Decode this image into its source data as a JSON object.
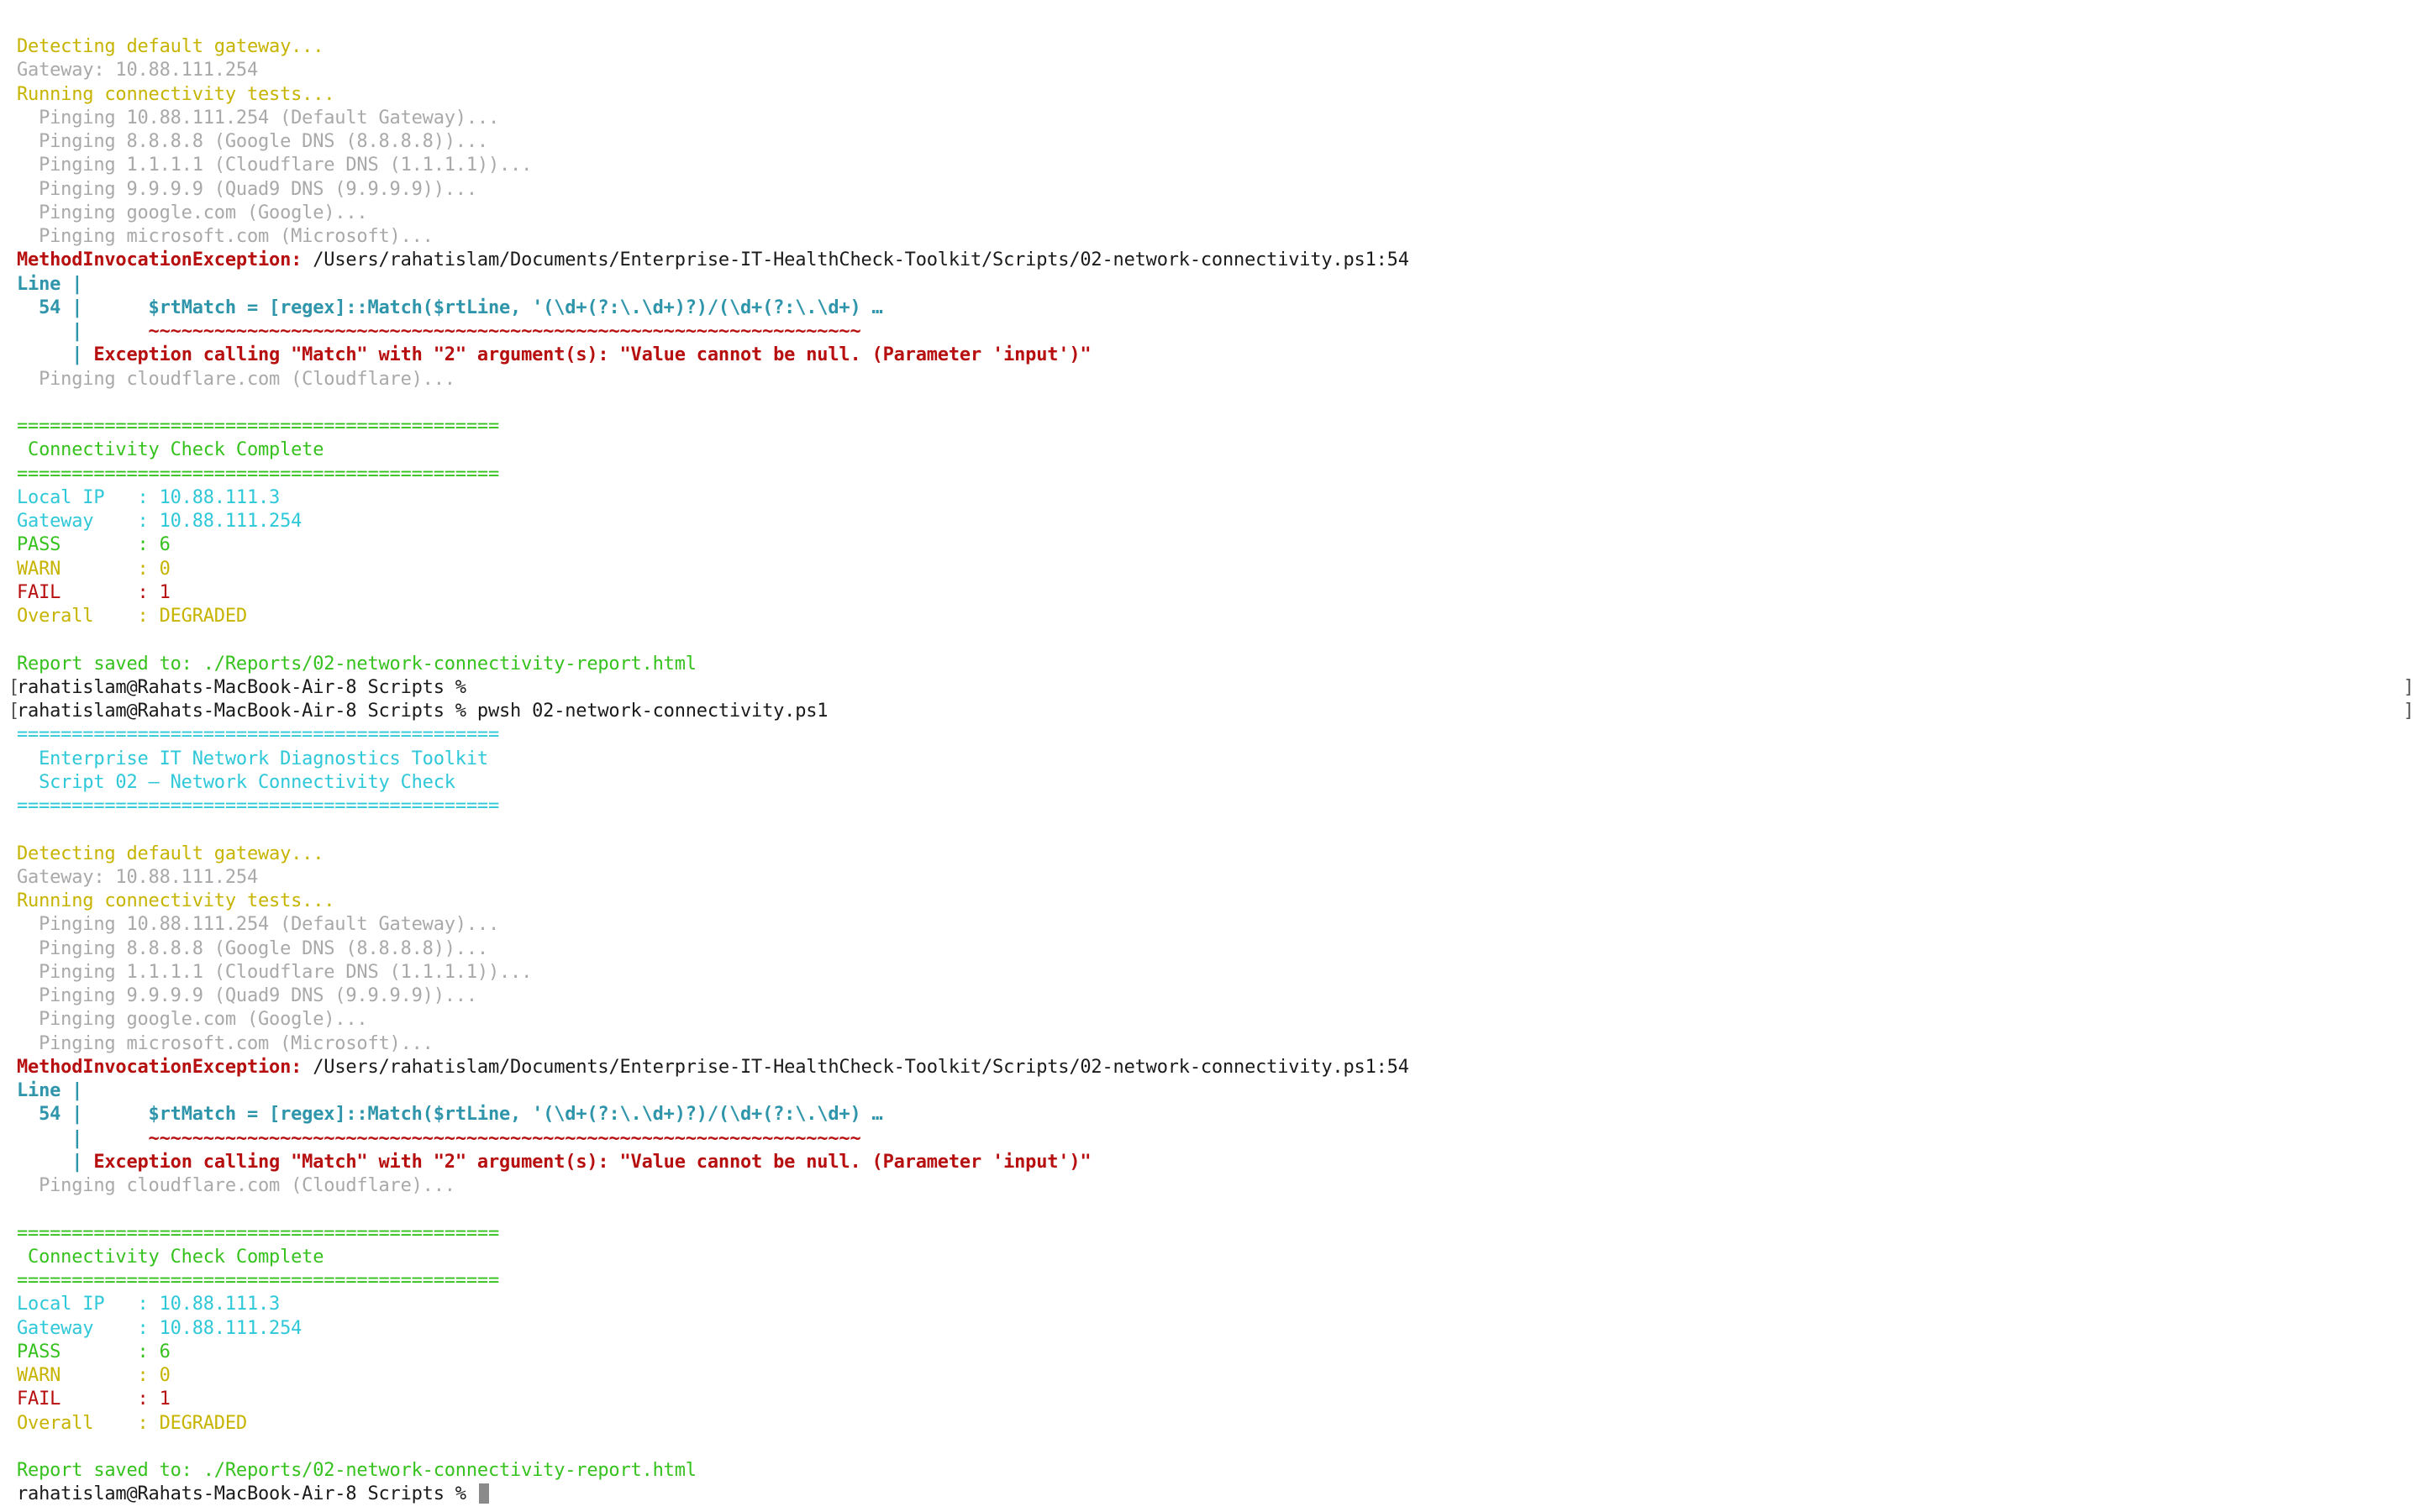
{
  "colors": {
    "yellow": "#c7b400",
    "gray": "#a9a9a9",
    "green": "#36c21e",
    "cyan": "#2ec8d8",
    "red": "#b70f0f",
    "teal": "#2f95ab",
    "default": "#1a1a1a",
    "background": "#ffffff",
    "cursor": "#8a8a8a"
  },
  "terminal_lines": [
    {
      "segs": [
        {
          "t": "Detecting default gateway...",
          "c": "yellow"
        }
      ]
    },
    {
      "segs": [
        {
          "t": "Gateway: 10.88.111.254",
          "c": "gray"
        }
      ]
    },
    {
      "segs": [
        {
          "t": "Running connectivity tests...",
          "c": "yellow"
        }
      ]
    },
    {
      "segs": [
        {
          "t": "  Pinging 10.88.111.254 (Default Gateway)...",
          "c": "gray"
        }
      ]
    },
    {
      "segs": [
        {
          "t": "  Pinging 8.8.8.8 (Google DNS (8.8.8.8))...",
          "c": "gray"
        }
      ]
    },
    {
      "segs": [
        {
          "t": "  Pinging 1.1.1.1 (Cloudflare DNS (1.1.1.1))...",
          "c": "gray"
        }
      ]
    },
    {
      "segs": [
        {
          "t": "  Pinging 9.9.9.9 (Quad9 DNS (9.9.9.9))...",
          "c": "gray"
        }
      ]
    },
    {
      "segs": [
        {
          "t": "  Pinging google.com (Google)...",
          "c": "gray"
        }
      ]
    },
    {
      "segs": [
        {
          "t": "  Pinging microsoft.com (Microsoft)...",
          "c": "gray"
        }
      ]
    },
    {
      "segs": [
        {
          "t": "MethodInvocationException:",
          "c": "red",
          "b": true
        },
        {
          "t": " /Users/rahatislam/Documents/Enterprise-IT-HealthCheck-Toolkit/Scripts/02-network-connectivity.ps1:54",
          "c": "default"
        }
      ]
    },
    {
      "segs": [
        {
          "t": "Line |",
          "c": "teal",
          "b": true
        }
      ]
    },
    {
      "segs": [
        {
          "t": "  54 | ",
          "c": "teal",
          "b": true
        },
        {
          "t": "     $rtMatch = [regex]::Match($rtLine, '(\\d+(?:\\.\\d+)?)/(\\d+(?:\\.\\d+) …",
          "c": "teal",
          "b": true
        }
      ]
    },
    {
      "segs": [
        {
          "t": "     | ",
          "c": "teal",
          "b": true
        },
        {
          "t": "     ~~~~~~~~~~~~~~~~~~~~~~~~~~~~~~~~~~~~~~~~~~~~~~~~~~~~~~~~~~~~~~~~~",
          "c": "red",
          "b": true
        }
      ]
    },
    {
      "segs": [
        {
          "t": "     | ",
          "c": "teal",
          "b": true
        },
        {
          "t": "Exception calling \"Match\" with \"2\" argument(s): \"Value cannot be null. (Parameter 'input')\"",
          "c": "red",
          "b": true
        }
      ]
    },
    {
      "segs": [
        {
          "t": "  Pinging cloudflare.com (Cloudflare)...",
          "c": "gray"
        }
      ]
    },
    {
      "segs": [
        {
          "t": "",
          "c": "default"
        }
      ]
    },
    {
      "segs": [
        {
          "t": "============================================",
          "c": "green"
        }
      ]
    },
    {
      "segs": [
        {
          "t": " Connectivity Check Complete",
          "c": "green"
        }
      ]
    },
    {
      "segs": [
        {
          "t": "============================================",
          "c": "green"
        }
      ]
    },
    {
      "segs": [
        {
          "t": "Local IP   : 10.88.111.3",
          "c": "cyan"
        }
      ]
    },
    {
      "segs": [
        {
          "t": "Gateway    : 10.88.111.254",
          "c": "cyan"
        }
      ]
    },
    {
      "segs": [
        {
          "t": "PASS       : 6",
          "c": "green"
        }
      ]
    },
    {
      "segs": [
        {
          "t": "WARN       : 0",
          "c": "yellow"
        }
      ]
    },
    {
      "segs": [
        {
          "t": "FAIL       : 1",
          "c": "red"
        }
      ]
    },
    {
      "segs": [
        {
          "t": "Overall    : DEGRADED",
          "c": "yellow"
        }
      ]
    },
    {
      "segs": [
        {
          "t": "",
          "c": "default"
        }
      ]
    },
    {
      "segs": [
        {
          "t": "Report saved to: ./Reports/02-network-connectivity-report.html",
          "c": "green"
        }
      ]
    },
    {
      "brackets": true,
      "segs": [
        {
          "t": "rahatislam@Rahats-MacBook-Air-8 Scripts % ",
          "c": "default"
        }
      ]
    },
    {
      "brackets": true,
      "segs": [
        {
          "t": "rahatislam@Rahats-MacBook-Air-8 Scripts % pwsh 02-network-connectivity.ps1",
          "c": "default"
        }
      ]
    },
    {
      "segs": [
        {
          "t": "============================================",
          "c": "cyan"
        }
      ]
    },
    {
      "segs": [
        {
          "t": "  Enterprise IT Network Diagnostics Toolkit",
          "c": "cyan"
        }
      ]
    },
    {
      "segs": [
        {
          "t": "  Script 02 — Network Connectivity Check",
          "c": "cyan"
        }
      ]
    },
    {
      "segs": [
        {
          "t": "============================================",
          "c": "cyan"
        }
      ]
    },
    {
      "segs": [
        {
          "t": "",
          "c": "default"
        }
      ]
    },
    {
      "segs": [
        {
          "t": "Detecting default gateway...",
          "c": "yellow"
        }
      ]
    },
    {
      "segs": [
        {
          "t": "Gateway: 10.88.111.254",
          "c": "gray"
        }
      ]
    },
    {
      "segs": [
        {
          "t": "Running connectivity tests...",
          "c": "yellow"
        }
      ]
    },
    {
      "segs": [
        {
          "t": "  Pinging 10.88.111.254 (Default Gateway)...",
          "c": "gray"
        }
      ]
    },
    {
      "segs": [
        {
          "t": "  Pinging 8.8.8.8 (Google DNS (8.8.8.8))...",
          "c": "gray"
        }
      ]
    },
    {
      "segs": [
        {
          "t": "  Pinging 1.1.1.1 (Cloudflare DNS (1.1.1.1))...",
          "c": "gray"
        }
      ]
    },
    {
      "segs": [
        {
          "t": "  Pinging 9.9.9.9 (Quad9 DNS (9.9.9.9))...",
          "c": "gray"
        }
      ]
    },
    {
      "segs": [
        {
          "t": "  Pinging google.com (Google)...",
          "c": "gray"
        }
      ]
    },
    {
      "segs": [
        {
          "t": "  Pinging microsoft.com (Microsoft)...",
          "c": "gray"
        }
      ]
    },
    {
      "segs": [
        {
          "t": "MethodInvocationException:",
          "c": "red",
          "b": true
        },
        {
          "t": " /Users/rahatislam/Documents/Enterprise-IT-HealthCheck-Toolkit/Scripts/02-network-connectivity.ps1:54",
          "c": "default"
        }
      ]
    },
    {
      "segs": [
        {
          "t": "Line |",
          "c": "teal",
          "b": true
        }
      ]
    },
    {
      "segs": [
        {
          "t": "  54 | ",
          "c": "teal",
          "b": true
        },
        {
          "t": "     $rtMatch = [regex]::Match($rtLine, '(\\d+(?:\\.\\d+)?)/(\\d+(?:\\.\\d+) …",
          "c": "teal",
          "b": true
        }
      ]
    },
    {
      "segs": [
        {
          "t": "     | ",
          "c": "teal",
          "b": true
        },
        {
          "t": "     ~~~~~~~~~~~~~~~~~~~~~~~~~~~~~~~~~~~~~~~~~~~~~~~~~~~~~~~~~~~~~~~~~",
          "c": "red",
          "b": true
        }
      ]
    },
    {
      "segs": [
        {
          "t": "     | ",
          "c": "teal",
          "b": true
        },
        {
          "t": "Exception calling \"Match\" with \"2\" argument(s): \"Value cannot be null. (Parameter 'input')\"",
          "c": "red",
          "b": true
        }
      ]
    },
    {
      "segs": [
        {
          "t": "  Pinging cloudflare.com (Cloudflare)...",
          "c": "gray"
        }
      ]
    },
    {
      "segs": [
        {
          "t": "",
          "c": "default"
        }
      ]
    },
    {
      "segs": [
        {
          "t": "============================================",
          "c": "green"
        }
      ]
    },
    {
      "segs": [
        {
          "t": " Connectivity Check Complete",
          "c": "green"
        }
      ]
    },
    {
      "segs": [
        {
          "t": "============================================",
          "c": "green"
        }
      ]
    },
    {
      "segs": [
        {
          "t": "Local IP   : 10.88.111.3",
          "c": "cyan"
        }
      ]
    },
    {
      "segs": [
        {
          "t": "Gateway    : 10.88.111.254",
          "c": "cyan"
        }
      ]
    },
    {
      "segs": [
        {
          "t": "PASS       : 6",
          "c": "green"
        }
      ]
    },
    {
      "segs": [
        {
          "t": "WARN       : 0",
          "c": "yellow"
        }
      ]
    },
    {
      "segs": [
        {
          "t": "FAIL       : 1",
          "c": "red"
        }
      ]
    },
    {
      "segs": [
        {
          "t": "Overall    : DEGRADED",
          "c": "yellow"
        }
      ]
    },
    {
      "segs": [
        {
          "t": "",
          "c": "default"
        }
      ]
    },
    {
      "segs": [
        {
          "t": "Report saved to: ./Reports/02-network-connectivity-report.html",
          "c": "green"
        }
      ]
    },
    {
      "cursor": true,
      "segs": [
        {
          "t": "rahatislam@Rahats-MacBook-Air-8 Scripts % ",
          "c": "default"
        }
      ]
    }
  ]
}
